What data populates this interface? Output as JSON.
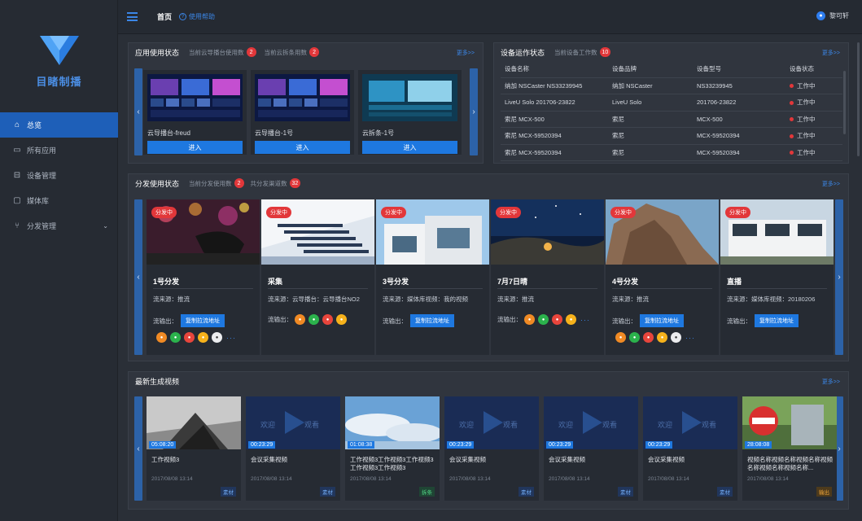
{
  "sidebar": {
    "logo_text": "目睹制播",
    "items": [
      {
        "label": "总览",
        "icon": "home-icon",
        "active": true
      },
      {
        "label": "所有应用",
        "icon": "apps-icon"
      },
      {
        "label": "设备管理",
        "icon": "device-icon"
      },
      {
        "label": "媒体库",
        "icon": "media-icon"
      },
      {
        "label": "分发管理",
        "icon": "share-icon",
        "expandable": true
      }
    ]
  },
  "topbar": {
    "home": "首页",
    "help": "使用帮助",
    "user": "黎可轩"
  },
  "app_usage": {
    "title": "应用使用状态",
    "sub1": "当前云导播台使用数",
    "sub1_count": "2",
    "sub2": "当前云拆条用数",
    "sub2_count": "2",
    "more": "更多>>",
    "apps": [
      {
        "name": "云导播台-freud",
        "button": "进入"
      },
      {
        "name": "云导播台-1号",
        "button": "进入"
      },
      {
        "name": "云拆条-1号",
        "button": "进入"
      }
    ]
  },
  "devices": {
    "title": "设备运作状态",
    "sub": "当前设备工作数",
    "count": "10",
    "more": "更多>>",
    "columns": [
      "设备名称",
      "设备品牌",
      "设备型号",
      "设备状态"
    ],
    "rows": [
      {
        "name": "纳加 NSCaster NS33239945",
        "brand": "纳加 NSCaster",
        "model": "NS33239945",
        "status": "工作中"
      },
      {
        "name": "LiveU Solo 201706-23822",
        "brand": "LiveU Solo",
        "model": "201706-23822",
        "status": "工作中"
      },
      {
        "name": "索尼 MCX-500",
        "brand": "索尼",
        "model": "MCX-500",
        "status": "工作中"
      },
      {
        "name": "索尼 MCX-59520394",
        "brand": "索尼",
        "model": "MCX-59520394",
        "status": "工作中"
      },
      {
        "name": "索尼 MCX-59520394",
        "brand": "索尼",
        "model": "MCX-59520394",
        "status": "工作中"
      }
    ]
  },
  "distribution": {
    "title": "分发使用状态",
    "sub1": "当前分发使用数",
    "sub1_count": "2",
    "sub2": "共分发渠道数",
    "sub2_count": "32",
    "more": "更多>>",
    "tag": "分发中",
    "src_label": "流来源：",
    "out_label": "流输出：",
    "copy_label": "复制拉流地址",
    "cards": [
      {
        "title": "1号分发",
        "source": "推流"
      },
      {
        "title": "采集",
        "source": "云导播台：云导播台NO2"
      },
      {
        "title": "3号分发",
        "source": "媒体库视频：我的视频"
      },
      {
        "title": "7月7日晴",
        "source": "推流"
      },
      {
        "title": "4号分发",
        "source": "推流"
      },
      {
        "title": "直播",
        "source": "媒体库视频：20180206"
      }
    ]
  },
  "videos": {
    "title": "最新生成视频",
    "more": "更多>>",
    "welcome": "欢迎",
    "watch": "观看",
    "items": [
      {
        "duration": "05:08:20",
        "title": "工作视频3",
        "date": "2017/08/08 13:14",
        "tag": "素材",
        "tag_type": "blue"
      },
      {
        "duration": "00:23:29",
        "title": "会议采集视频",
        "date": "2017/08/08 13:14",
        "tag": "素材",
        "tag_type": "blue"
      },
      {
        "duration": "01:08:38",
        "title": "工作视频3工作视频3工作视频3工作视频3工作视频3",
        "date": "2017/08/08 13:14",
        "tag": "拆条",
        "tag_type": "green"
      },
      {
        "duration": "00:23:29",
        "title": "会议采集视频",
        "date": "2017/08/08 13:14",
        "tag": "素材",
        "tag_type": "blue"
      },
      {
        "duration": "00:23:29",
        "title": "会议采集视频",
        "date": "2017/08/08 13:14",
        "tag": "素材",
        "tag_type": "blue"
      },
      {
        "duration": "00:23:29",
        "title": "会议采集视频",
        "date": "2017/08/08 13:14",
        "tag": "素材",
        "tag_type": "blue"
      },
      {
        "duration": "28:08:08",
        "title": "视频名称视频名称视频名称视频名称视频名称视频名称...",
        "date": "2017/08/08 13:14",
        "tag": "输出",
        "tag_type": "orange"
      }
    ]
  },
  "colors": {
    "accent": "#1e78e0",
    "badge": "#e2373a",
    "panel": "#30353e",
    "bg": "#2a2f37"
  }
}
